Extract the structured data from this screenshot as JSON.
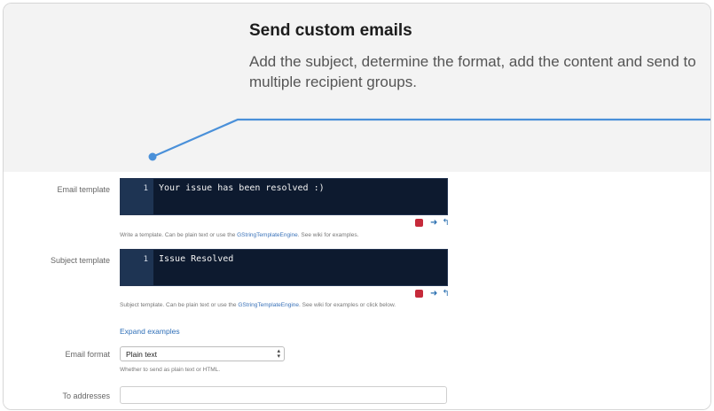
{
  "banner": {
    "title": "Send custom emails",
    "description": "Add the subject, determine the format, add the content and send to multiple recipient groups."
  },
  "form": {
    "email_template": {
      "label": "Email template",
      "line_number": "1",
      "code": "Your issue has been resolved :)",
      "help_prefix": "Write a template. Can be plain text or use the ",
      "help_link": "GStringTemplateEngine",
      "help_suffix": ". See wiki for examples."
    },
    "subject_template": {
      "label": "Subject template",
      "line_number": "1",
      "code": "Issue Resolved",
      "help_prefix": "Subject template. Can be plain text or use the ",
      "help_link": "GStringTemplateEngine",
      "help_suffix": ". See wiki for examples or click below.",
      "expand_label": "Expand examples"
    },
    "email_format": {
      "label": "Email format",
      "selected": "Plain text",
      "help": "Whether to send as plain text or HTML."
    },
    "to_addresses": {
      "label": "To addresses",
      "value": ""
    }
  },
  "icons": {
    "editor_tools": [
      "fullscreen-icon",
      "arrow-right-icon",
      "return-icon"
    ],
    "select_caret": "updown-caret-icon"
  },
  "colors": {
    "editor_bg": "#0d1a2f",
    "gutter_bg": "#1e3453",
    "callout_line": "#4a90d9",
    "link": "#3b73b9",
    "banner_bg": "#f3f3f3"
  }
}
